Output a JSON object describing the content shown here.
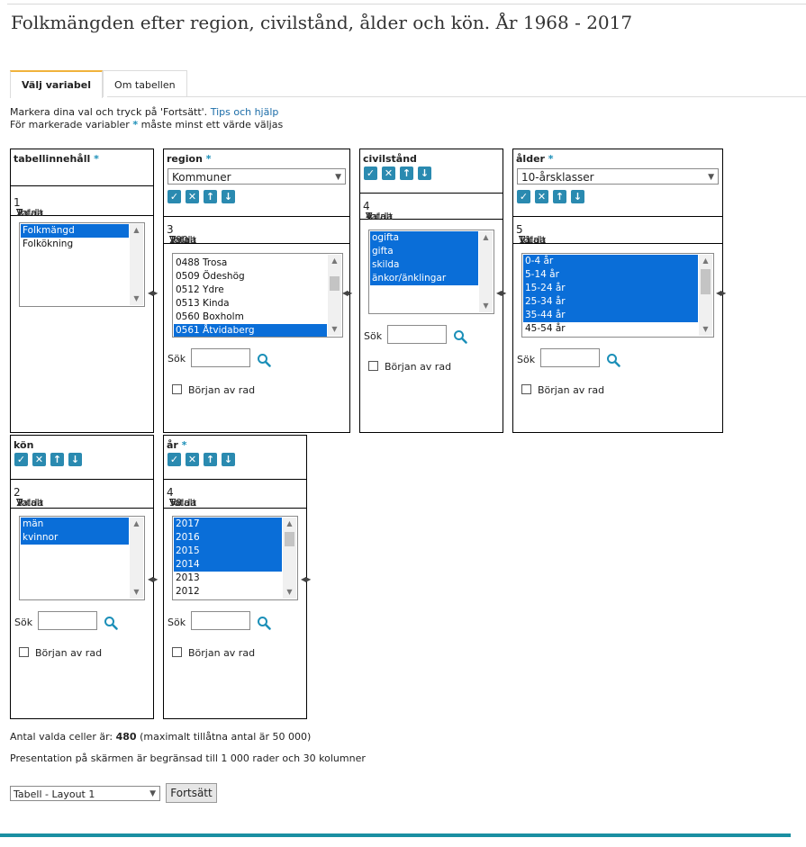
{
  "page": {
    "title": "Folkmängden efter region, civilstånd, ålder och kön. År 1968 - 2017"
  },
  "tabs": [
    {
      "label": "Välj variabel",
      "active": true
    },
    {
      "label": "Om tabellen",
      "active": false
    }
  ],
  "intro": {
    "line1": "Markera dina val och tryck på 'Fortsätt'. ",
    "help_link": "Tips och hjälp",
    "line2a": "För markerade variabler ",
    "line2b": " måste minst ett värde väljas",
    "star": "*"
  },
  "common": {
    "search_label": "Sök",
    "begin_label": "Början av rad",
    "totals_prefix": "Totalt",
    "selected_word": "Valda"
  },
  "variables": {
    "tabellinnehall": {
      "title": "tabellinnehåll",
      "required": true,
      "total": "2",
      "selected": "1",
      "items": [
        {
          "label": "Folkmängd",
          "selected": true
        },
        {
          "label": "Folkökning",
          "selected": false
        }
      ]
    },
    "region": {
      "title": "region",
      "required": true,
      "dropdown": "Kommuner",
      "total": "290",
      "selected": "3",
      "items": [
        {
          "label": "0488 Trosa",
          "selected": false
        },
        {
          "label": "0509 Ödeshög",
          "selected": false
        },
        {
          "label": "0512 Ydre",
          "selected": false
        },
        {
          "label": "0513 Kinda",
          "selected": false
        },
        {
          "label": "0560 Boxholm",
          "selected": false
        },
        {
          "label": "0561 Åtvidaberg",
          "selected": true
        }
      ]
    },
    "civilstand": {
      "title": "civilstånd",
      "required": false,
      "total": "4",
      "selected": "4",
      "items": [
        {
          "label": "ogifta",
          "selected": true
        },
        {
          "label": "gifta",
          "selected": true
        },
        {
          "label": "skilda",
          "selected": true
        },
        {
          "label": "änkor/änklingar",
          "selected": true
        }
      ]
    },
    "alder": {
      "title": "ålder",
      "required": true,
      "dropdown": "10-årsklasser",
      "total": "11",
      "selected": "5",
      "items": [
        {
          "label": "0-4 år",
          "selected": true
        },
        {
          "label": "5-14 år",
          "selected": true
        },
        {
          "label": "15-24 år",
          "selected": true
        },
        {
          "label": "25-34 år",
          "selected": true
        },
        {
          "label": "35-44 år",
          "selected": true
        },
        {
          "label": "45-54 år",
          "selected": false
        }
      ]
    },
    "kon": {
      "title": "kön",
      "required": false,
      "total": "2",
      "selected": "2",
      "items": [
        {
          "label": "män",
          "selected": true
        },
        {
          "label": "kvinnor",
          "selected": true
        }
      ]
    },
    "ar": {
      "title": "år",
      "required": true,
      "total": "50",
      "selected": "4",
      "items": [
        {
          "label": "2017",
          "selected": true
        },
        {
          "label": "2016",
          "selected": true
        },
        {
          "label": "2015",
          "selected": true
        },
        {
          "label": "2014",
          "selected": true
        },
        {
          "label": "2013",
          "selected": false
        },
        {
          "label": "2012",
          "selected": false
        }
      ]
    }
  },
  "footer": {
    "cells_label": "Antal valda celler är:",
    "cells_value": "480",
    "cells_max": "(maximalt tillåtna antal är 50 000)",
    "presentation": "Presentation på skärmen är begränsad till 1 000 rader och 30 kolumner",
    "layout_select": "Tabell - Layout 1",
    "continue_button": "Fortsätt"
  }
}
